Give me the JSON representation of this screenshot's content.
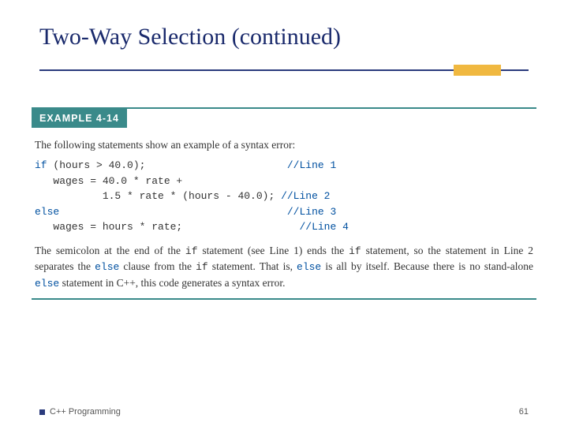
{
  "title": "Two-Way Selection (continued)",
  "example": {
    "header": "EXAMPLE 4-14",
    "intro": "The following statements show an example of a syntax error:",
    "code": {
      "l1a": "if",
      "l1b": " (hours > 40.0);",
      "l1c": "//Line 1",
      "l2a": "   wages = 40.0 * rate +",
      "l2b": "           1.5 * rate * (hours - 40.0); ",
      "l2c": "//Line 2",
      "l3a": "else",
      "l3c": "//Line 3",
      "l4a": "   wages = hours * rate;",
      "l4c": "//Line 4"
    },
    "explain": {
      "p1": "The semicolon at the end of the ",
      "c1": "if",
      "p2": " statement (see Line 1) ends the ",
      "c2": "if",
      "p3": " statement, so the statement in Line 2 separates the ",
      "c3": "else",
      "p4": " clause from the ",
      "c4": "if",
      "p5": " statement. That is, ",
      "c5": "else",
      "p6": " is all by itself. Because there is no stand-alone ",
      "c6": "else",
      "p7": " statement in C++, this code generates a syntax error."
    }
  },
  "footer": {
    "title": "C++ Programming",
    "page": "61"
  }
}
